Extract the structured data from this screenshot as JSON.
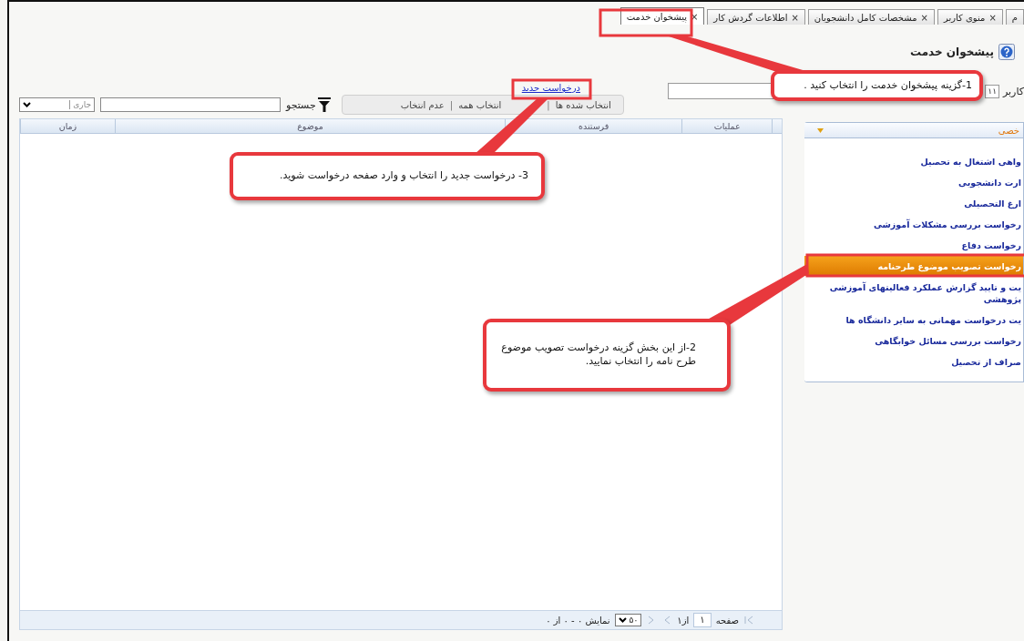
{
  "tabs": [
    {
      "label": "م",
      "selected": false
    },
    {
      "label": "منوی کاربر",
      "close": "×",
      "selected": false
    },
    {
      "label": "مشخصات کامل دانشجویان",
      "close": "×",
      "selected": false
    },
    {
      "label": "اطلاعات گردش کار",
      "close": "×",
      "selected": false
    },
    {
      "label": "پیشخوان خدمت",
      "close": "×",
      "selected": true
    }
  ],
  "page_title": "پیشخوان خدمت",
  "user_field": {
    "label": "کاربر",
    "value": "۱۱"
  },
  "new_request_link": "درخواست جدید",
  "selection_bar": {
    "selected": "انتخاب شده ها",
    "select_all": "انتخاب همه",
    "select_none": "عدم انتخاب",
    "separators": [
      "|",
      "|"
    ]
  },
  "search": {
    "button": "جستجو",
    "status_value": "جاری"
  },
  "table": {
    "columns": [
      "عملیات",
      "فرستنده",
      "موضوع",
      "زمان"
    ]
  },
  "pager": {
    "page_label": "صفحه",
    "page": "۱",
    "of": "از۱",
    "page_size": "۵۰",
    "summary": "نمایش ۰ - ۰ از ۰"
  },
  "sidebar": {
    "header": "خصی",
    "items": [
      {
        "label": "واهی اشتغال به تحصیل",
        "selected": false
      },
      {
        "label": "ارت دانشجویی",
        "selected": false
      },
      {
        "label": "ارغ التحصیلی",
        "selected": false
      },
      {
        "label": "رخواست بررسی مشکلات آموزشی",
        "selected": false
      },
      {
        "label": "رخواست دفاع",
        "selected": false
      },
      {
        "label": "رخواست تصویب موضوع طرحنامه",
        "selected": true
      },
      {
        "label": "یت و تایید گزارش عملکرد فعالیتهای آموزشی پژوهشی",
        "selected": false
      },
      {
        "label": "یت درخواست مهمانی به سایر دانشگاه ها",
        "selected": false
      },
      {
        "label": "رخواست بررسی مسائل خوابگاهی",
        "selected": false
      },
      {
        "label": "صراف از تحصیل",
        "selected": false
      }
    ]
  },
  "callouts": [
    {
      "text": "1-گزینه پیشخوان خدمت را انتخاب کنید ."
    },
    {
      "text": "2-از این بخش گزینه درخواست تصویب موضوع  طرح نامه را انتخاب نمایید."
    },
    {
      "text": "3- درخواست جدید را انتخاب و وارد صفحه درخواست شوید."
    }
  ]
}
